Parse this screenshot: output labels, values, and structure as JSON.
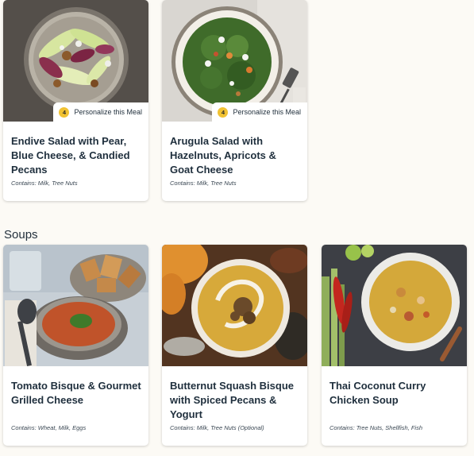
{
  "salads": [
    {
      "title": "Endive Salad with Pear, Blue Cheese, & Candied Pecans",
      "contains": "Contains: Milk, Tree Nuts",
      "personalize": {
        "count": "4",
        "label": "Personalize this Meal"
      }
    },
    {
      "title": "Arugula Salad with Hazelnuts, Apricots & Goat Cheese",
      "contains": "Contains: Milk, Tree Nuts",
      "personalize": {
        "count": "4",
        "label": "Personalize this Meal"
      }
    }
  ],
  "soups_section": {
    "title": "Soups",
    "items": [
      {
        "title": "Tomato Bisque & Gourmet Grilled Cheese",
        "contains": "Contains: Wheat, Milk, Eggs"
      },
      {
        "title": "Butternut Squash Bisque with Spiced Pecans & Yogurt",
        "contains": "Contains: Milk, Tree Nuts (Optional)"
      },
      {
        "title": "Thai Coconut Curry Chicken Soup",
        "contains": "Contains: Tree Nuts, Shellfish, Fish"
      }
    ]
  }
}
